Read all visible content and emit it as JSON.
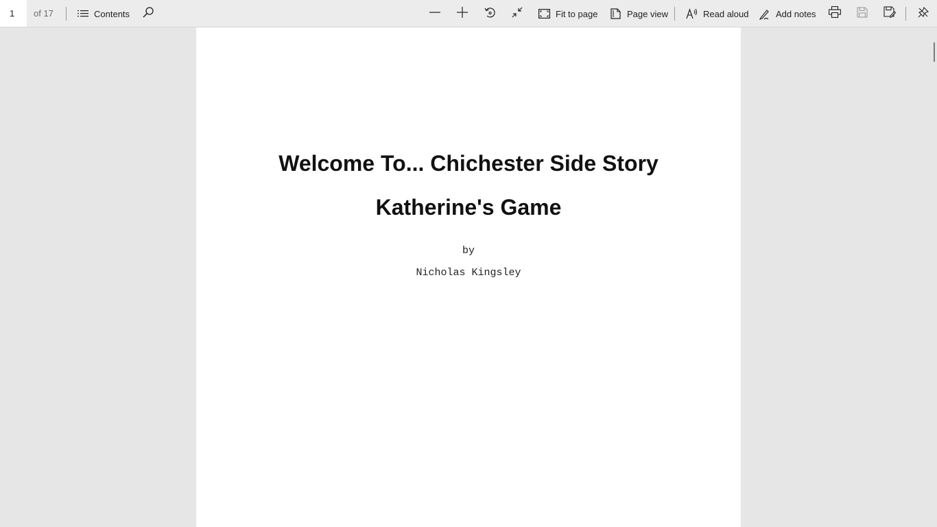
{
  "toolbar": {
    "page_number": "1",
    "page_count": "of 17",
    "contents_label": "Contents",
    "fit_to_page_label": "Fit to page",
    "page_view_label": "Page view",
    "read_aloud_label": "Read aloud",
    "add_notes_label": "Add notes",
    "icons": {
      "contents": "list-icon",
      "search": "search-icon",
      "zoom_out": "minus-icon",
      "zoom_in": "plus-icon",
      "rotate": "rotate-icon",
      "collapse": "collapse-icon",
      "fit": "fit-to-page-icon",
      "page_view": "page-view-icon",
      "read_aloud": "read-aloud-icon",
      "add_notes": "pen-icon",
      "print": "print-icon",
      "save": "save-icon",
      "save_as": "save-as-icon",
      "pin": "pin-icon"
    }
  },
  "document": {
    "title": "Welcome To... Chichester Side Story",
    "subtitle": "Katherine's Game",
    "by": "by",
    "author": "Nicholas Kingsley"
  },
  "colors": {
    "toolbar_bg": "#ececec",
    "canvas_bg": "#e6e6e6",
    "page_bg": "#ffffff",
    "text": "#111111"
  }
}
